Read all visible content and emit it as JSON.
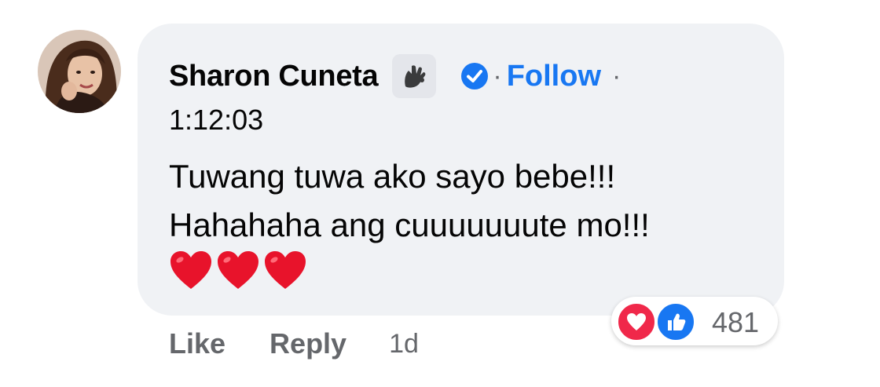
{
  "comment": {
    "author": "Sharon Cuneta",
    "follow_label": "Follow",
    "separator": "·",
    "timestamp_link": "1:12:03",
    "text_line1": "Tuwang tuwa ako sayo bebe!!!",
    "text_line2": "Hahahaha ang cuuuuuuute mo!!!",
    "emoji": [
      "heart",
      "heart",
      "heart"
    ],
    "badge_icon": "fan-badge-icon",
    "verified_icon": "verified-check-icon"
  },
  "reactions": {
    "types": [
      "love",
      "like"
    ],
    "count": "481"
  },
  "actions": {
    "like": "Like",
    "reply": "Reply",
    "age": "1d"
  },
  "colors": {
    "bubble": "#f0f2f5",
    "link": "#1877f2",
    "secondary_text": "#65676b",
    "love": "#f0284a"
  }
}
